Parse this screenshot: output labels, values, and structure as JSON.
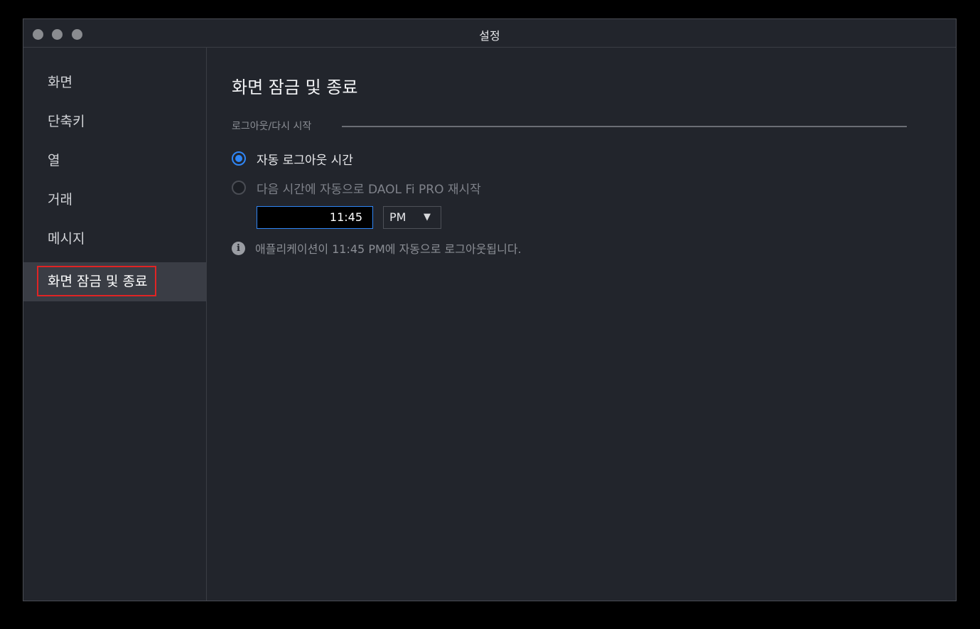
{
  "window": {
    "title": "설정"
  },
  "sidebar": {
    "items": [
      {
        "label": "화면"
      },
      {
        "label": "단축키"
      },
      {
        "label": "열"
      },
      {
        "label": "거래"
      },
      {
        "label": "메시지"
      },
      {
        "label": "화면 잠금 및 종료",
        "active": true
      }
    ]
  },
  "main": {
    "title": "화면 잠금 및 종료",
    "section_label": "로그아웃/다시 시작",
    "options": [
      {
        "label": "자동 로그아웃 시간",
        "selected": true
      },
      {
        "label": "다음 시간에 자동으로 DAOL Fi PRO 재시작",
        "selected": false
      }
    ],
    "time_value": "11:45",
    "ampm_value": "PM",
    "info_text": "애플리케이션이 11:45 PM에 자동으로 로그아웃됩니다."
  },
  "icons": {
    "info": "info-icon",
    "dropdown": "caret-down-icon"
  },
  "colors": {
    "accent": "#2f86f6",
    "highlight_box": "#e02424",
    "background": "#22252c"
  }
}
